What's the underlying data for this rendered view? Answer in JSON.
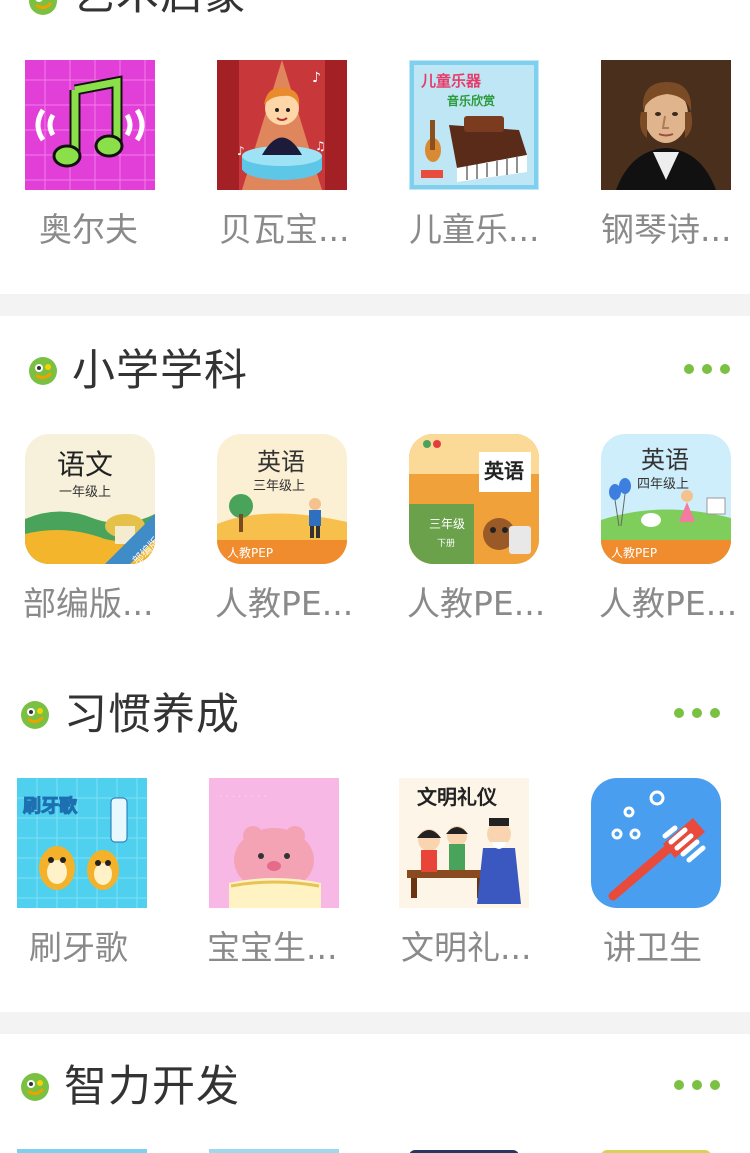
{
  "sections": [
    {
      "title": "艺术启蒙",
      "has_more": false,
      "items": [
        {
          "label": "奥尔夫",
          "icon": "music-note-thumbnail"
        },
        {
          "label": "贝瓦宝...",
          "icon": "singing-boy-thumbnail"
        },
        {
          "label": "儿童乐...",
          "icon": "piano-thumbnail",
          "art_text": [
            "儿童乐器",
            "音乐欣赏"
          ]
        },
        {
          "label": "钢琴诗...",
          "icon": "portrait-thumbnail"
        }
      ]
    },
    {
      "title": "小学学科",
      "has_more": true,
      "items": [
        {
          "label": "部编版...",
          "icon": "textbook-chinese-thumbnail",
          "art_text": [
            "语文",
            "一年级上",
            "部编版"
          ]
        },
        {
          "label": "人教PE...",
          "icon": "textbook-english-grade3-thumbnail",
          "art_text": [
            "英语",
            "三年级上",
            "人教PEP"
          ]
        },
        {
          "label": "人教PE...",
          "icon": "textbook-english-lower-thumbnail",
          "art_text": [
            "英语",
            "三年级",
            "下册"
          ]
        },
        {
          "label": "人教PE...",
          "icon": "textbook-english-grade4-thumbnail",
          "art_text": [
            "英语",
            "四年级上",
            "人教PEP"
          ]
        }
      ]
    },
    {
      "title": "习惯养成",
      "has_more": true,
      "items": [
        {
          "label": "刷牙歌",
          "icon": "toothbrush-song-thumbnail",
          "art_text": [
            "刷牙歌"
          ]
        },
        {
          "label": "宝宝生...",
          "icon": "baby-life-thumbnail"
        },
        {
          "label": "文明礼...",
          "icon": "etiquette-thumbnail",
          "art_text": [
            "文明礼仪"
          ]
        },
        {
          "label": "讲卫生",
          "icon": "hygiene-toothbrush-thumbnail"
        }
      ]
    },
    {
      "title": "智力开发",
      "has_more": true,
      "items": []
    }
  ],
  "colors": {
    "accent_green": "#7ac143",
    "label_gray": "#8a8a8a",
    "title_text": "#333333",
    "divider": "#f3f3f3"
  },
  "icons": {
    "section_icon": "green-mascot-icon",
    "more_icon": "more-dots-icon"
  }
}
